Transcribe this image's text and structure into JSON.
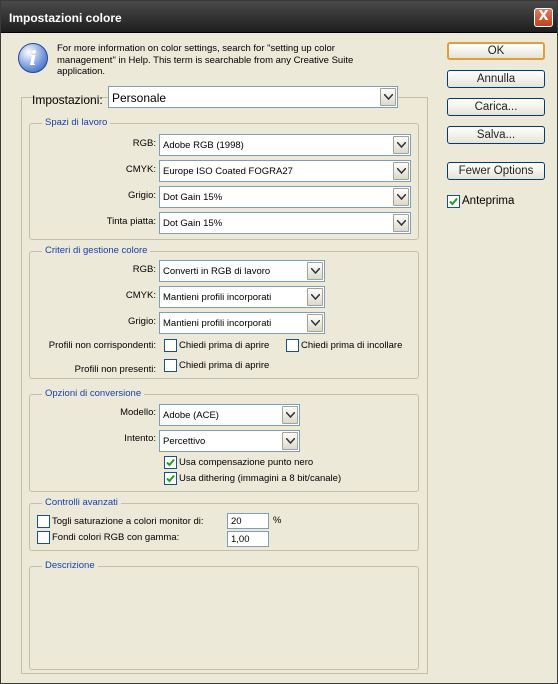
{
  "window": {
    "title": "Impostazioni colore",
    "close_glyph": "X"
  },
  "info": {
    "icon": "info-icon",
    "icon_glyph": "i",
    "text": "For more information on color settings, search for \"setting up color management\" in Help. This term is searchable from any Creative Suite application."
  },
  "settings": {
    "label": "Impostazioni:",
    "value": "Personale"
  },
  "working_spaces": {
    "legend": "Spazi di lavoro",
    "rgb_label": "RGB:",
    "rgb_value": "Adobe RGB (1998)",
    "cmyk_label": "CMYK:",
    "cmyk_value": "Europe ISO Coated FOGRA27",
    "gray_label": "Grigio:",
    "gray_value": "Dot Gain 15%",
    "spot_label": "Tinta piatta:",
    "spot_value": "Dot Gain 15%"
  },
  "policies": {
    "legend": "Criteri di gestione colore",
    "rgb_label": "RGB:",
    "rgb_value": "Converti in RGB di lavoro",
    "cmyk_label": "CMYK:",
    "cmyk_value": "Mantieni profili incorporati",
    "gray_label": "Grigio:",
    "gray_value": "Mantieni profili incorporati",
    "mismatch_label": "Profili non corrispondenti:",
    "mismatch_open": "Chiedi prima di aprire",
    "mismatch_paste": "Chiedi prima di incollare",
    "missing_label": "Profili non presenti:",
    "missing_open": "Chiedi prima di aprire"
  },
  "conversion": {
    "legend": "Opzioni di conversione",
    "engine_label": "Modello:",
    "engine_value": "Adobe (ACE)",
    "intent_label": "Intento:",
    "intent_value": "Percettivo",
    "bpc_label": "Usa compensazione punto nero",
    "dither_label": "Usa dithering (immagini a 8 bit/canale)"
  },
  "advanced": {
    "legend": "Controlli avanzati",
    "desaturate_label": "Togli saturazione a colori monitor di:",
    "desaturate_value": "20",
    "desaturate_unit": "%",
    "blend_label": "Fondi colori RGB con gamma:",
    "blend_value": "1,00"
  },
  "description": {
    "legend": "Descrizione"
  },
  "buttons": {
    "ok": "OK",
    "cancel": "Annulla",
    "load": "Carica...",
    "save": "Salva...",
    "fewer": "Fewer Options",
    "preview": "Anteprima"
  },
  "states": {
    "preview_checked": true,
    "bpc_checked": true,
    "dither_checked": true,
    "mismatch_open_checked": false,
    "mismatch_paste_checked": false,
    "missing_open_checked": false,
    "desaturate_checked": false,
    "blend_checked": false
  },
  "colors": {
    "legend_blue": "#1b3dab",
    "default_button_border": "#e49b3a",
    "dialog_bg": "#ece9d8"
  }
}
